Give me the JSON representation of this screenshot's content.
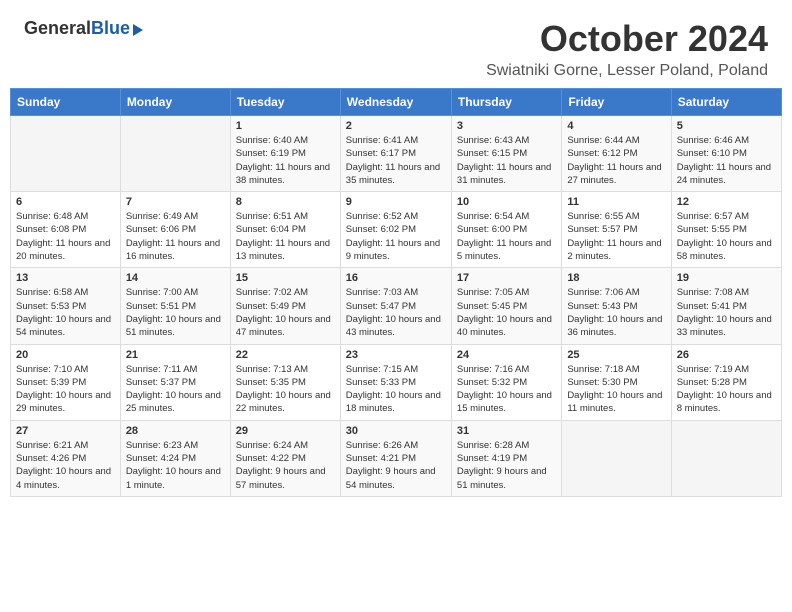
{
  "header": {
    "logo_general": "General",
    "logo_blue": "Blue",
    "title": "October 2024",
    "subtitle": "Swiatniki Gorne, Lesser Poland, Poland"
  },
  "weekdays": [
    "Sunday",
    "Monday",
    "Tuesday",
    "Wednesday",
    "Thursday",
    "Friday",
    "Saturday"
  ],
  "weeks": [
    [
      {
        "day": "",
        "empty": true
      },
      {
        "day": "",
        "empty": true
      },
      {
        "day": "1",
        "sunrise": "6:40 AM",
        "sunset": "6:19 PM",
        "daylight": "11 hours and 38 minutes."
      },
      {
        "day": "2",
        "sunrise": "6:41 AM",
        "sunset": "6:17 PM",
        "daylight": "11 hours and 35 minutes."
      },
      {
        "day": "3",
        "sunrise": "6:43 AM",
        "sunset": "6:15 PM",
        "daylight": "11 hours and 31 minutes."
      },
      {
        "day": "4",
        "sunrise": "6:44 AM",
        "sunset": "6:12 PM",
        "daylight": "11 hours and 27 minutes."
      },
      {
        "day": "5",
        "sunrise": "6:46 AM",
        "sunset": "6:10 PM",
        "daylight": "11 hours and 24 minutes."
      }
    ],
    [
      {
        "day": "6",
        "sunrise": "6:48 AM",
        "sunset": "6:08 PM",
        "daylight": "11 hours and 20 minutes."
      },
      {
        "day": "7",
        "sunrise": "6:49 AM",
        "sunset": "6:06 PM",
        "daylight": "11 hours and 16 minutes."
      },
      {
        "day": "8",
        "sunrise": "6:51 AM",
        "sunset": "6:04 PM",
        "daylight": "11 hours and 13 minutes."
      },
      {
        "day": "9",
        "sunrise": "6:52 AM",
        "sunset": "6:02 PM",
        "daylight": "11 hours and 9 minutes."
      },
      {
        "day": "10",
        "sunrise": "6:54 AM",
        "sunset": "6:00 PM",
        "daylight": "11 hours and 5 minutes."
      },
      {
        "day": "11",
        "sunrise": "6:55 AM",
        "sunset": "5:57 PM",
        "daylight": "11 hours and 2 minutes."
      },
      {
        "day": "12",
        "sunrise": "6:57 AM",
        "sunset": "5:55 PM",
        "daylight": "10 hours and 58 minutes."
      }
    ],
    [
      {
        "day": "13",
        "sunrise": "6:58 AM",
        "sunset": "5:53 PM",
        "daylight": "10 hours and 54 minutes."
      },
      {
        "day": "14",
        "sunrise": "7:00 AM",
        "sunset": "5:51 PM",
        "daylight": "10 hours and 51 minutes."
      },
      {
        "day": "15",
        "sunrise": "7:02 AM",
        "sunset": "5:49 PM",
        "daylight": "10 hours and 47 minutes."
      },
      {
        "day": "16",
        "sunrise": "7:03 AM",
        "sunset": "5:47 PM",
        "daylight": "10 hours and 43 minutes."
      },
      {
        "day": "17",
        "sunrise": "7:05 AM",
        "sunset": "5:45 PM",
        "daylight": "10 hours and 40 minutes."
      },
      {
        "day": "18",
        "sunrise": "7:06 AM",
        "sunset": "5:43 PM",
        "daylight": "10 hours and 36 minutes."
      },
      {
        "day": "19",
        "sunrise": "7:08 AM",
        "sunset": "5:41 PM",
        "daylight": "10 hours and 33 minutes."
      }
    ],
    [
      {
        "day": "20",
        "sunrise": "7:10 AM",
        "sunset": "5:39 PM",
        "daylight": "10 hours and 29 minutes."
      },
      {
        "day": "21",
        "sunrise": "7:11 AM",
        "sunset": "5:37 PM",
        "daylight": "10 hours and 25 minutes."
      },
      {
        "day": "22",
        "sunrise": "7:13 AM",
        "sunset": "5:35 PM",
        "daylight": "10 hours and 22 minutes."
      },
      {
        "day": "23",
        "sunrise": "7:15 AM",
        "sunset": "5:33 PM",
        "daylight": "10 hours and 18 minutes."
      },
      {
        "day": "24",
        "sunrise": "7:16 AM",
        "sunset": "5:32 PM",
        "daylight": "10 hours and 15 minutes."
      },
      {
        "day": "25",
        "sunrise": "7:18 AM",
        "sunset": "5:30 PM",
        "daylight": "10 hours and 11 minutes."
      },
      {
        "day": "26",
        "sunrise": "7:19 AM",
        "sunset": "5:28 PM",
        "daylight": "10 hours and 8 minutes."
      }
    ],
    [
      {
        "day": "27",
        "sunrise": "6:21 AM",
        "sunset": "4:26 PM",
        "daylight": "10 hours and 4 minutes."
      },
      {
        "day": "28",
        "sunrise": "6:23 AM",
        "sunset": "4:24 PM",
        "daylight": "10 hours and 1 minute."
      },
      {
        "day": "29",
        "sunrise": "6:24 AM",
        "sunset": "4:22 PM",
        "daylight": "9 hours and 57 minutes."
      },
      {
        "day": "30",
        "sunrise": "6:26 AM",
        "sunset": "4:21 PM",
        "daylight": "9 hours and 54 minutes."
      },
      {
        "day": "31",
        "sunrise": "6:28 AM",
        "sunset": "4:19 PM",
        "daylight": "9 hours and 51 minutes."
      },
      {
        "day": "",
        "empty": true
      },
      {
        "day": "",
        "empty": true
      }
    ]
  ]
}
